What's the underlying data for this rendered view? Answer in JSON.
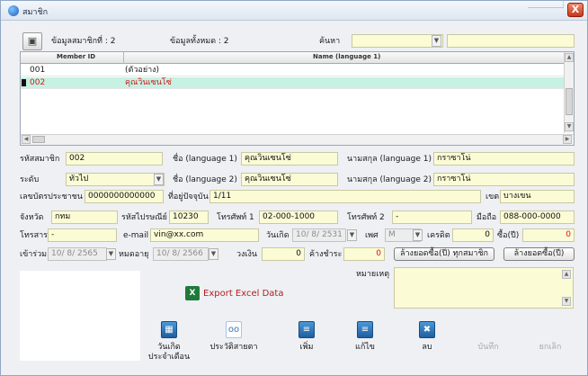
{
  "window": {
    "title": "สมาชิก",
    "close_label": "X"
  },
  "toolbar": {
    "member_data_label": "ข้อมูลสมาชิกที่ : 2",
    "total_data_label": "ข้อมูลทั้งหมด : 2",
    "search_label": "ค้นหา",
    "search_value": "",
    "search_text_value": ""
  },
  "grid": {
    "columns": [
      "Member ID",
      "Name (language 1)"
    ],
    "rows": [
      {
        "id": "001",
        "name": "(ตัวอย่าง)"
      },
      {
        "id": "002",
        "name": "คุณวินเซนโซ่"
      }
    ]
  },
  "form": {
    "member_code_label": "รหัสสมาชิก",
    "member_code": "002",
    "name1_label": "ชื่อ (language 1)",
    "name1": "คุณวินเซนโซ่",
    "surname1_label": "นามสกุล (language 1)",
    "surname1": "กราซาโน่",
    "level_label": "ระดับ",
    "level": "ทั่วไป",
    "name2_label": "ชื่อ (language 2)",
    "name2": "คุณวินเซนโซ่",
    "surname2_label": "นามสกุล (language 2)",
    "surname2": "กราซาโน่",
    "id_card_label": "เลขบัตรประชาชน",
    "id_card": "0000000000000",
    "address_label": "ที่อยู่ปัจจุบัน",
    "address": "1/11",
    "district_label": "เขต",
    "district": "บางเขน",
    "province_label": "จังหวัด",
    "province": "กทม",
    "postal_label": "รหัสไปรษณีย์",
    "postal": "10230",
    "phone1_label": "โทรศัพท์ 1",
    "phone1": "02-000-1000",
    "phone2_label": "โทรศัพท์ 2",
    "phone2": "-",
    "mobile_label": "มือถือ",
    "mobile": "088-000-0000",
    "fax_label": "โทรสาร",
    "fax": "-",
    "email_label": "e-mail",
    "email": "vin@xx.com",
    "birthday_label": "วันเกิด",
    "birthday": "10/ 8/ 2531",
    "gender_label": "เพศ",
    "gender": "M",
    "credit_label": "เครดิต",
    "credit": "0",
    "buy_year_label": "ซื้อ(ปี)",
    "buy_year": "0",
    "join_label": "เข้าร่วม",
    "join_date": "10/ 8/ 2565",
    "expire_label": "หมดอายุ",
    "expire_date": "10/ 8/ 2566",
    "limit_label": "วงเงิน",
    "limit": "0",
    "outstanding_label": "ค้างชำระ",
    "outstanding": "0",
    "clear_all_button": "ล้างยอดซื้อ(ปี) ทุกสมาชิก",
    "clear_button": "ล้างยอดซื้อ(ปี)",
    "notes_label": "หมายเหตุ"
  },
  "export_label": "Export Excel Data",
  "actions": {
    "birthday": "วันเกิด\nประจำเดือน",
    "history": "ประวัติสายตา",
    "add": "เพิ่ม",
    "edit": "แก้ไข",
    "delete": "ลบ",
    "save": "บันทึก",
    "cancel": "ยกเลิก"
  }
}
